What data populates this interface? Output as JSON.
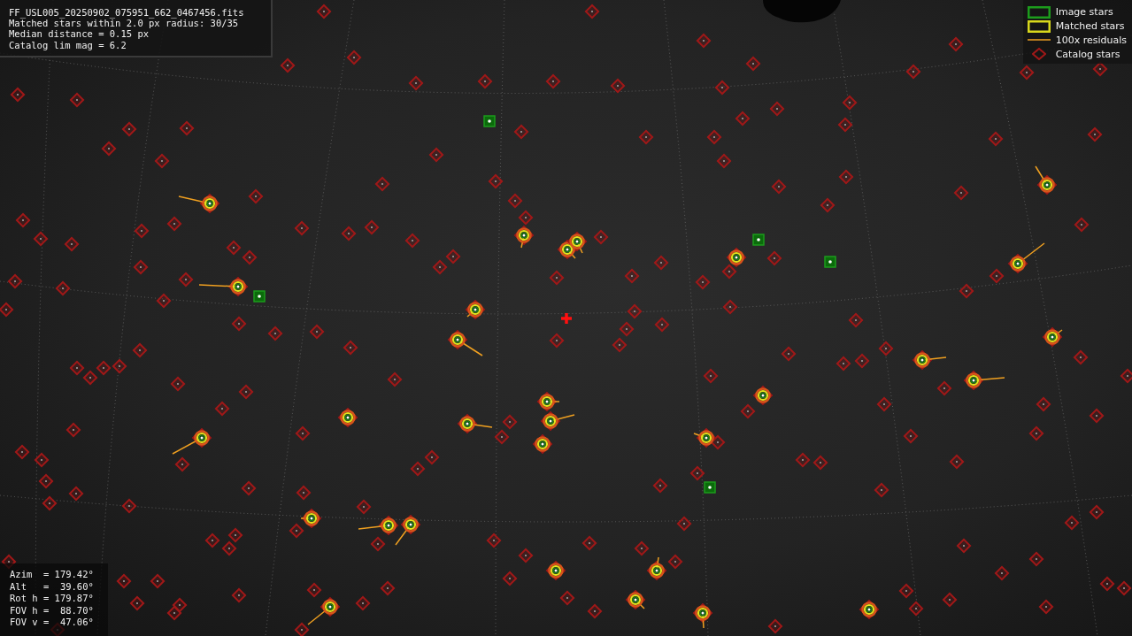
{
  "file_info": {
    "lines": [
      "FF_USL005_20250902_075951_662_0467456.fits",
      "Matched stars within 2.0 px radius: 30/35",
      "Median distance = 0.15 px",
      "Catalog lim mag = 6.2"
    ]
  },
  "legend": {
    "items": [
      {
        "kind": "image",
        "label": "Image stars"
      },
      {
        "kind": "matched",
        "label": "Matched stars"
      },
      {
        "kind": "residual",
        "label": "100x residuals"
      },
      {
        "kind": "catalog",
        "label": "Catalog stars"
      }
    ]
  },
  "pointing": {
    "lines": [
      "Azim  = 179.42°",
      "Alt   =  39.60°",
      "Rot h = 179.87°",
      "FOV h =  88.70°",
      "FOV v =  47.06°"
    ]
  }
}
